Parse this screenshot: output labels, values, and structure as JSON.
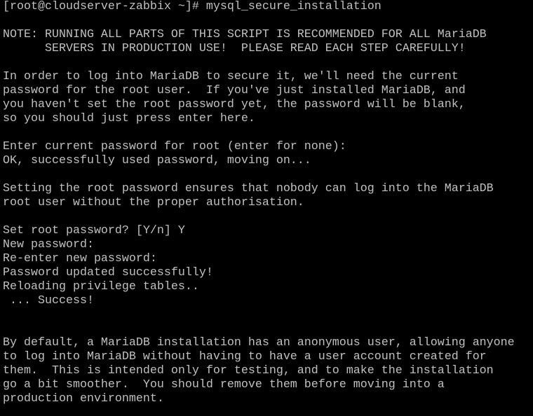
{
  "terminal": {
    "lines": [
      "[root@cloudserver-zabbix ~]# mysql_secure_installation",
      "",
      "NOTE: RUNNING ALL PARTS OF THIS SCRIPT IS RECOMMENDED FOR ALL MariaDB",
      "      SERVERS IN PRODUCTION USE!  PLEASE READ EACH STEP CAREFULLY!",
      "",
      "In order to log into MariaDB to secure it, we'll need the current",
      "password for the root user.  If you've just installed MariaDB, and",
      "you haven't set the root password yet, the password will be blank,",
      "so you should just press enter here.",
      "",
      "Enter current password for root (enter for none):",
      "OK, successfully used password, moving on...",
      "",
      "Setting the root password ensures that nobody can log into the MariaDB",
      "root user without the proper authorisation.",
      "",
      "Set root password? [Y/n] Y",
      "New password:",
      "Re-enter new password:",
      "Password updated successfully!",
      "Reloading privilege tables..",
      " ... Success!",
      "",
      "",
      "By default, a MariaDB installation has an anonymous user, allowing anyone",
      "to log into MariaDB without having to have a user account created for",
      "them.  This is intended only for testing, and to make the installation",
      "go a bit smoother.  You should remove them before moving into a",
      "production environment."
    ]
  },
  "colors": {
    "background": "#000000",
    "foreground": "#c0c0c0"
  }
}
